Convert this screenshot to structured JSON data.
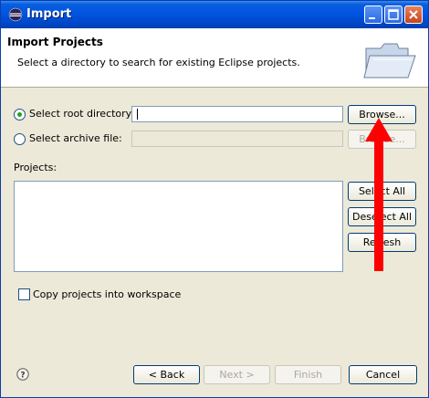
{
  "window": {
    "title": "Import"
  },
  "header": {
    "title": "Import Projects",
    "description": "Select a directory to search for existing Eclipse projects."
  },
  "source": {
    "root_option_label": "Select root directory:",
    "root_value": "",
    "root_selected": true,
    "archive_option_label": "Select archive file:",
    "archive_value": "",
    "browse_label": "Browse...",
    "browse_archive_label": "Browse..."
  },
  "projects": {
    "label": "Projects:",
    "items": [],
    "select_all_label": "Select All",
    "deselect_all_label": "Deselect All",
    "refresh_label": "Refresh"
  },
  "options": {
    "copy_label": "Copy projects into workspace",
    "copy_checked": false
  },
  "footer": {
    "back_label": "< Back",
    "next_label": "Next >",
    "finish_label": "Finish",
    "cancel_label": "Cancel"
  },
  "icons": {
    "window": "eclipse-icon",
    "banner": "folder-open-icon",
    "help": "help-icon",
    "annotation": "red-arrow-up"
  },
  "colors": {
    "titlebar": "#0054e3",
    "accent": "#21a121",
    "annotation": "#ff0000"
  }
}
